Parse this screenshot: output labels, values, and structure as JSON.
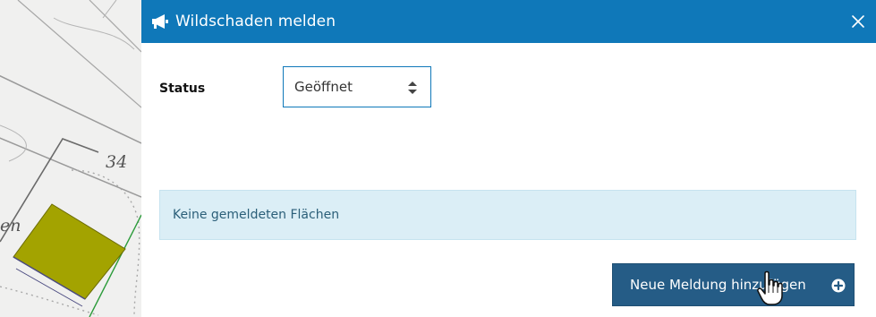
{
  "dialog": {
    "title": "Wildschaden melden",
    "title_icon": "megaphone-icon",
    "close_icon": "close-icon",
    "accent_color": "#0f78b9"
  },
  "form": {
    "status_label": "Status",
    "status_value": "Geöffnet",
    "status_icon": "select-arrows-icon"
  },
  "info": {
    "message": "Keine gemeldeten Flächen",
    "background_color": "#dbeef6"
  },
  "actions": {
    "add_label": "Neue Meldung hinzufügen",
    "add_icon": "plus-circle-icon",
    "button_color": "#255c86"
  },
  "map": {
    "label_number": "34",
    "label_text": "en",
    "parcel_color": "#a3a300"
  }
}
